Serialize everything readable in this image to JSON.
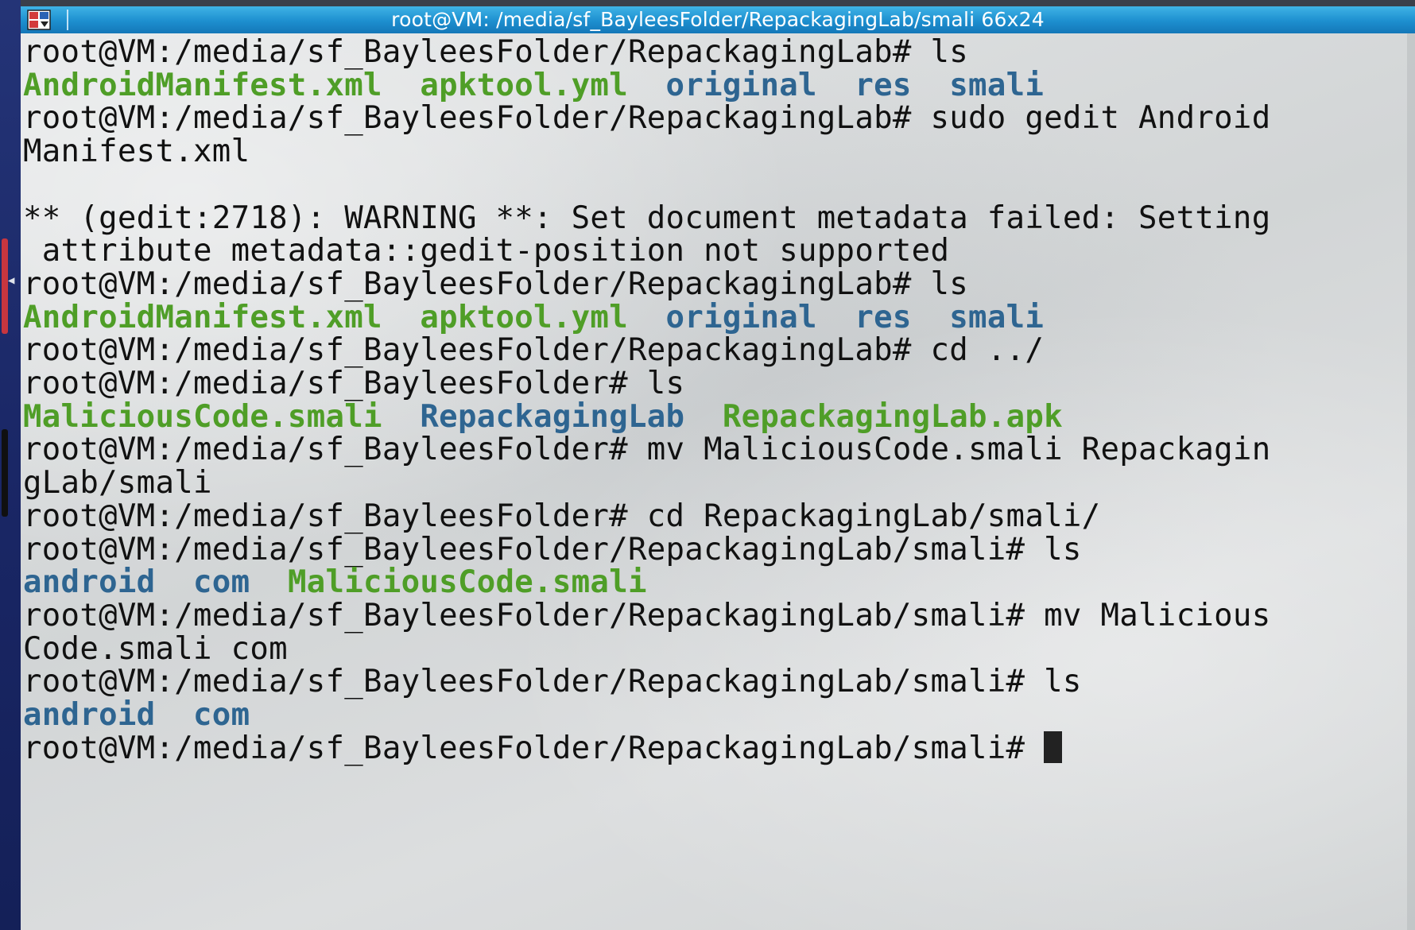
{
  "window": {
    "title": "root@VM: /media/sf_BayleesFolder/RepackagingLab/smali 66x24"
  },
  "colors": {
    "prompt_text": "#111111",
    "file": "#4f9e27",
    "directory": "#2e6591",
    "titlebar": "#1d8fcf"
  },
  "terminal": {
    "lines": [
      [
        {
          "t": "root@VM:/media/sf_BayleesFolder/RepackagingLab# ls",
          "c": ""
        }
      ],
      [
        {
          "t": "AndroidManifest.xml",
          "c": "green"
        },
        {
          "t": "  ",
          "c": ""
        },
        {
          "t": "apktool.yml",
          "c": "green"
        },
        {
          "t": "  ",
          "c": ""
        },
        {
          "t": "original",
          "c": "blue"
        },
        {
          "t": "  ",
          "c": ""
        },
        {
          "t": "res",
          "c": "blue"
        },
        {
          "t": "  ",
          "c": ""
        },
        {
          "t": "smali",
          "c": "blue"
        }
      ],
      [
        {
          "t": "root@VM:/media/sf_BayleesFolder/RepackagingLab# sudo gedit Android",
          "c": ""
        }
      ],
      [
        {
          "t": "Manifest.xml",
          "c": ""
        }
      ],
      [],
      [
        {
          "t": "** (gedit:2718): WARNING **: Set document metadata failed: Setting",
          "c": ""
        }
      ],
      [
        {
          "t": " attribute metadata::gedit-position not supported",
          "c": ""
        }
      ],
      [
        {
          "t": "root@VM:/media/sf_BayleesFolder/RepackagingLab# ls",
          "c": ""
        }
      ],
      [
        {
          "t": "AndroidManifest.xml",
          "c": "green"
        },
        {
          "t": "  ",
          "c": ""
        },
        {
          "t": "apktool.yml",
          "c": "green"
        },
        {
          "t": "  ",
          "c": ""
        },
        {
          "t": "original",
          "c": "blue"
        },
        {
          "t": "  ",
          "c": ""
        },
        {
          "t": "res",
          "c": "blue"
        },
        {
          "t": "  ",
          "c": ""
        },
        {
          "t": "smali",
          "c": "blue"
        }
      ],
      [
        {
          "t": "root@VM:/media/sf_BayleesFolder/RepackagingLab# cd ../",
          "c": ""
        }
      ],
      [
        {
          "t": "root@VM:/media/sf_BayleesFolder# ls",
          "c": ""
        }
      ],
      [
        {
          "t": "MaliciousCode.smali",
          "c": "green"
        },
        {
          "t": "  ",
          "c": ""
        },
        {
          "t": "RepackagingLab",
          "c": "blue"
        },
        {
          "t": "  ",
          "c": ""
        },
        {
          "t": "RepackagingLab.apk",
          "c": "green"
        }
      ],
      [
        {
          "t": "root@VM:/media/sf_BayleesFolder# mv MaliciousCode.smali Repackagin",
          "c": ""
        }
      ],
      [
        {
          "t": "gLab/smali",
          "c": ""
        }
      ],
      [
        {
          "t": "root@VM:/media/sf_BayleesFolder# cd RepackagingLab/smali/",
          "c": ""
        }
      ],
      [
        {
          "t": "root@VM:/media/sf_BayleesFolder/RepackagingLab/smali# ls",
          "c": ""
        }
      ],
      [
        {
          "t": "android",
          "c": "blue"
        },
        {
          "t": "  ",
          "c": ""
        },
        {
          "t": "com",
          "c": "blue"
        },
        {
          "t": "  ",
          "c": ""
        },
        {
          "t": "MaliciousCode.smali",
          "c": "green"
        }
      ],
      [
        {
          "t": "root@VM:/media/sf_BayleesFolder/RepackagingLab/smali# mv Malicious",
          "c": ""
        }
      ],
      [
        {
          "t": "Code.smali com",
          "c": ""
        }
      ],
      [
        {
          "t": "root@VM:/media/sf_BayleesFolder/RepackagingLab/smali# ls",
          "c": ""
        }
      ],
      [
        {
          "t": "android",
          "c": "blue"
        },
        {
          "t": "  ",
          "c": ""
        },
        {
          "t": "com",
          "c": "blue"
        }
      ],
      [
        {
          "t": "root@VM:/media/sf_BayleesFolder/RepackagingLab/smali# ",
          "c": ""
        }
      ]
    ]
  }
}
